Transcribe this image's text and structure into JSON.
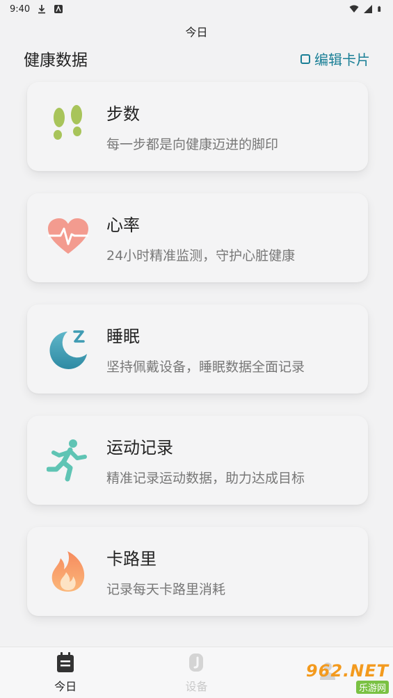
{
  "status_bar": {
    "time": "9:40"
  },
  "header": {
    "title": "今日"
  },
  "section": {
    "title": "健康数据",
    "edit_label": "编辑卡片"
  },
  "cards": [
    {
      "title": "步数",
      "desc": "每一步都是向健康迈进的脚印",
      "icon": "footprints-icon"
    },
    {
      "title": "心率",
      "desc": "24小时精准监测，守护心脏健康",
      "icon": "heart-rate-icon"
    },
    {
      "title": "睡眠",
      "desc": "坚持佩戴设备，睡眠数据全面记录",
      "icon": "moon-sleep-icon"
    },
    {
      "title": "运动记录",
      "desc": "精准记录运动数据，助力达成目标",
      "icon": "running-person-icon"
    },
    {
      "title": "卡路里",
      "desc": "记录每天卡路里消耗",
      "icon": "flame-icon"
    }
  ],
  "bottom_nav": {
    "items": [
      {
        "label": "今日",
        "active": true
      },
      {
        "label": "设备",
        "active": false
      },
      {
        "label": "",
        "active": false
      }
    ]
  },
  "watermark": {
    "top": "962.NET",
    "bottom": "乐游网"
  },
  "colors": {
    "accent": "#1a7f96",
    "footprint": "#a8c45a",
    "heart": "#f08a80",
    "moon": "#3f9bb3",
    "runner": "#5fc4b4",
    "flame": "#f7a060"
  }
}
